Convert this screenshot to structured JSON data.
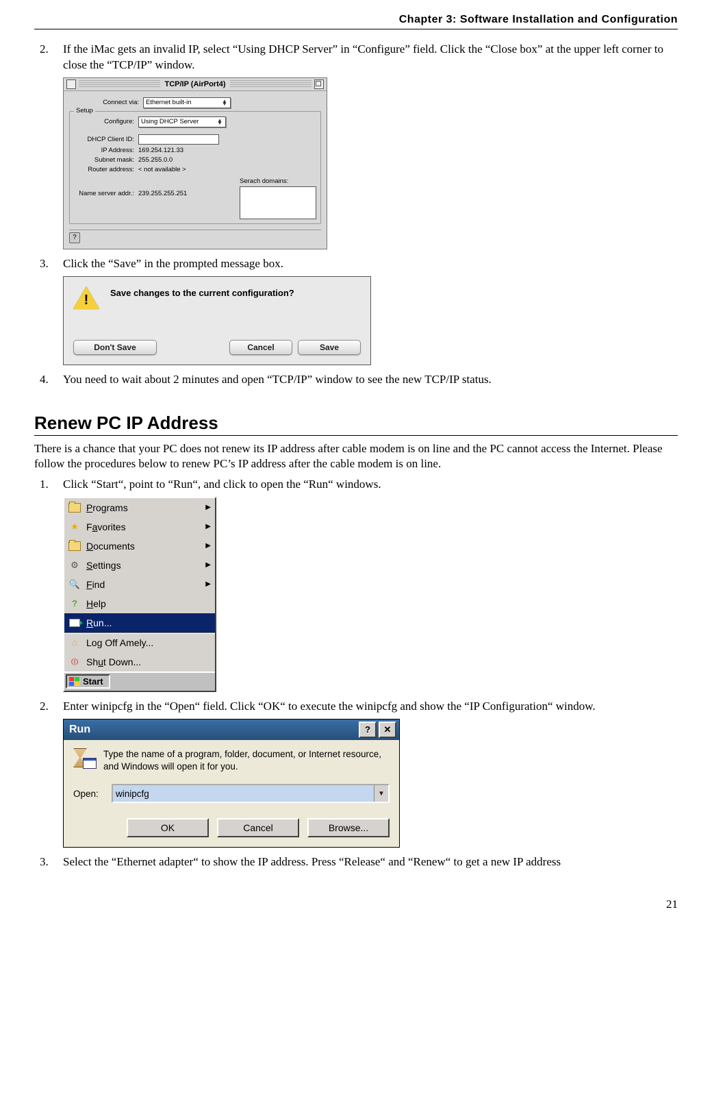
{
  "header": {
    "chapter": "Chapter 3: Software Installation and Configuration"
  },
  "steps_a": {
    "s2": {
      "num": "2.",
      "text": "If the iMac gets an invalid IP, select “Using DHCP Server” in “Configure” field. Click the “Close box” at the upper left corner to close the “TCP/IP” window."
    },
    "s3": {
      "num": "3.",
      "text": "Click the “Save” in the prompted message box."
    },
    "s4": {
      "num": "4.",
      "text": "You need to wait about 2 minutes and open “TCP/IP” window to see the new TCP/IP status."
    }
  },
  "mac_panel": {
    "title": "TCP/IP (AirPort4)",
    "connect_via_label": "Connect via:",
    "connect_via_value": "Ethernet built-in",
    "setup_legend": "Setup",
    "configure_label": "Configure:",
    "configure_value": "Using DHCP Server",
    "dhcp_client_label": "DHCP Client ID:",
    "dhcp_client_value": "",
    "ip_label": "IP Address:",
    "ip_value": "169.254.121.33",
    "subnet_label": "Subnet mask:",
    "subnet_value": "255.255.0.0",
    "router_label": "Router address:",
    "router_value": "< not available >",
    "ns_label": "Name server addr.:",
    "ns_value": "239.255.255.251",
    "search_domains_label": "Serach domains:",
    "help_char": "?"
  },
  "save_dialog": {
    "message": "Save changes to the current configuration?",
    "dont_save": "Don't Save",
    "cancel": "Cancel",
    "save": "Save"
  },
  "section": {
    "heading": "Renew PC IP Address",
    "intro": "There is a chance that your PC does not renew its IP address after cable modem is on line and the PC cannot access the Internet. Please follow the procedures below to renew PC’s IP address after the cable modem is on line."
  },
  "steps_b": {
    "s1": {
      "num": "1.",
      "text": "Click “Start“, point to “Run“, and click to open the “Run“ windows."
    },
    "s2": {
      "num": "2.",
      "text": "Enter winipcfg in the “Open“ field. Click “OK“ to execute the winipcfg and show the “IP Configuration“ window."
    },
    "s3": {
      "num": "3.",
      "text": "Select the “Ethernet adapter“ to show the IP address. Press “Release“ and “Renew“ to get a new IP address"
    }
  },
  "start_menu": {
    "programs": "Programs",
    "favorites": "Favorites",
    "documents": "Documents",
    "settings": "Settings",
    "find": "Find",
    "help": "Help",
    "run": "Run...",
    "logoff": "Log Off Amely...",
    "shutdown": "Shut Down...",
    "start": "Start"
  },
  "run_dialog": {
    "title": "Run",
    "help_char": "?",
    "close_char": "✕",
    "description": "Type the name of a program, folder, document, or Internet resource, and Windows will open it for you.",
    "open_label": "Open:",
    "open_value": "winipcfg",
    "ok": "OK",
    "cancel": "Cancel",
    "browse": "Browse..."
  },
  "page_number": "21"
}
